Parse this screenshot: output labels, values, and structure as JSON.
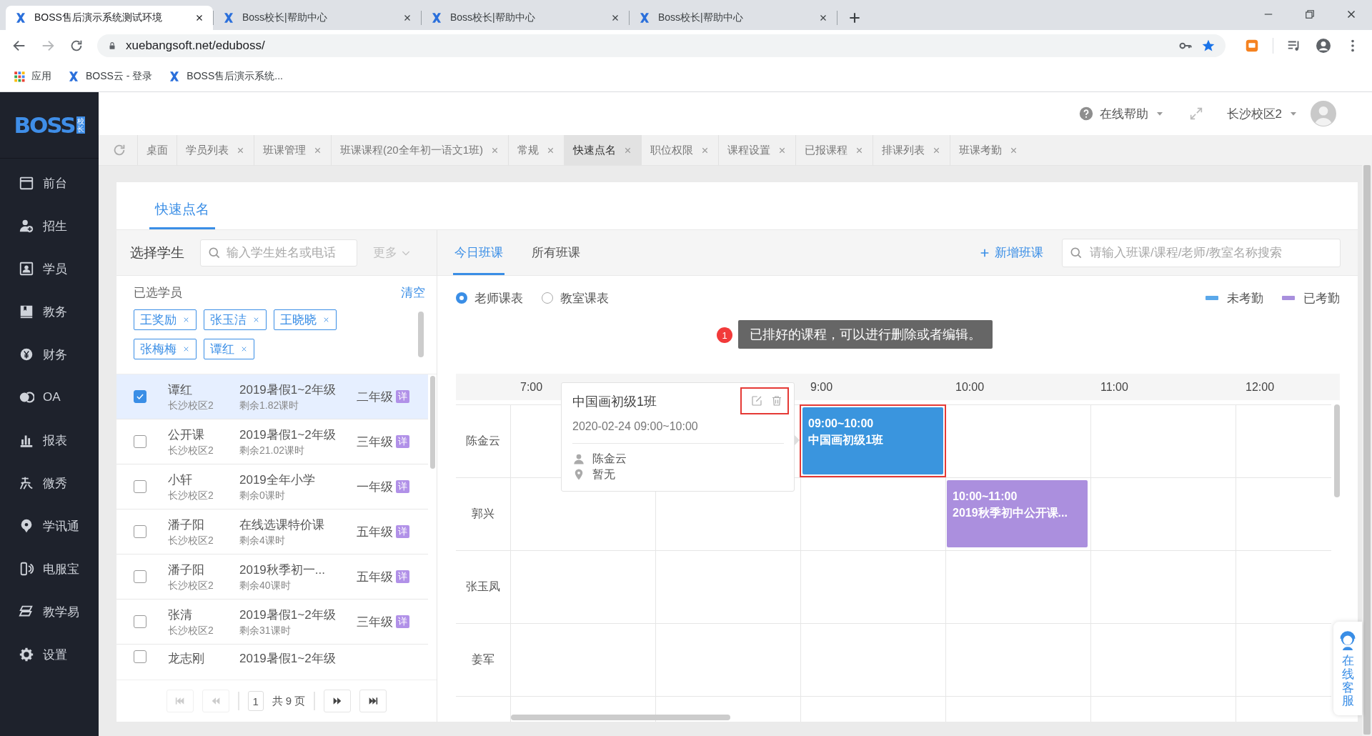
{
  "browser": {
    "tabs": [
      {
        "title": "BOSS售后演示系统测试环境",
        "selected": true
      },
      {
        "title": "Boss校长|帮助中心",
        "selected": false
      },
      {
        "title": "Boss校长|帮助中心",
        "selected": false
      },
      {
        "title": "Boss校长|帮助中心",
        "selected": false
      }
    ],
    "url": "xuebangsoft.net/eduboss/",
    "bookmarks": [
      {
        "label": "应用",
        "kind": "apps"
      },
      {
        "label": "BOSS云 - 登录",
        "kind": "site"
      },
      {
        "label": "BOSS售后演示系统...",
        "kind": "site"
      }
    ]
  },
  "logo": {
    "text": "BOSS",
    "badge": "校长"
  },
  "sidebar": {
    "items": [
      {
        "label": "前台",
        "kind": "calendar"
      },
      {
        "label": "招生",
        "kind": "user-add"
      },
      {
        "label": "学员",
        "kind": "profile"
      },
      {
        "label": "教务",
        "kind": "book"
      },
      {
        "label": "财务",
        "kind": "yen"
      },
      {
        "label": "OA",
        "kind": "chat"
      },
      {
        "label": "报表",
        "kind": "chart"
      },
      {
        "label": "微秀",
        "kind": "brush"
      },
      {
        "label": "学讯通",
        "kind": "pin"
      },
      {
        "label": "电服宝",
        "kind": "phone"
      },
      {
        "label": "教学易",
        "kind": "books"
      },
      {
        "label": "设置",
        "kind": "gear"
      }
    ]
  },
  "header": {
    "help": "在线帮助",
    "campus": "长沙校区2"
  },
  "page_tabs": [
    {
      "label": "桌面",
      "closable": false,
      "selected": false
    },
    {
      "label": "学员列表",
      "closable": true,
      "selected": false
    },
    {
      "label": "班课管理",
      "closable": true,
      "selected": false
    },
    {
      "label": "班课课程(20全年初一语文1班)",
      "closable": true,
      "selected": false
    },
    {
      "label": "常规",
      "closable": true,
      "selected": false
    },
    {
      "label": "快速点名",
      "closable": true,
      "selected": true
    },
    {
      "label": "职位权限",
      "closable": true,
      "selected": false
    },
    {
      "label": "课程设置",
      "closable": true,
      "selected": false
    },
    {
      "label": "已报课程",
      "closable": true,
      "selected": false
    },
    {
      "label": "排课列表",
      "closable": true,
      "selected": false
    },
    {
      "label": "班课考勤",
      "closable": true,
      "selected": false
    }
  ],
  "page_title": "快速点名",
  "students": {
    "heading": "选择学生",
    "search_placeholder": "输入学生姓名或电话",
    "more": "更多",
    "selected_label": "已选学员",
    "clear": "清空",
    "tags": [
      "王奖励",
      "张玉洁",
      "王晓晓",
      "张梅梅",
      "谭红"
    ],
    "rows": [
      {
        "name": "谭红",
        "campus": "长沙校区2",
        "course": "2019暑假1~2年级",
        "remaining": "剩余1.82课时",
        "grade": "二年级",
        "detail": "详",
        "checked": true
      },
      {
        "name": "公开课",
        "campus": "长沙校区2",
        "course": "2019暑假1~2年级",
        "remaining": "剩余21.02课时",
        "grade": "三年级",
        "detail": "详",
        "checked": false
      },
      {
        "name": "小轩",
        "campus": "长沙校区2",
        "course": "2019全年小学",
        "remaining": "剩余0课时",
        "grade": "一年级",
        "detail": "详",
        "checked": false
      },
      {
        "name": "潘子阳",
        "campus": "长沙校区2",
        "course": "在线选课特价课",
        "remaining": "剩余4课时",
        "grade": "五年级",
        "detail": "详",
        "checked": false
      },
      {
        "name": "潘子阳",
        "campus": "长沙校区2",
        "course": "2019秋季初一...",
        "remaining": "剩余40课时",
        "grade": "五年级",
        "detail": "详",
        "checked": false
      },
      {
        "name": "张清",
        "campus": "长沙校区2",
        "course": "2019暑假1~2年级",
        "remaining": "剩余31课时",
        "grade": "三年级",
        "detail": "详",
        "checked": false
      },
      {
        "name": "龙志刚",
        "course": "2019暑假1~2年级",
        "checked": false
      }
    ],
    "pagination": {
      "page": "1",
      "total": "共 9 页"
    }
  },
  "schedule": {
    "tabs": [
      {
        "label": "今日班课",
        "selected": true
      },
      {
        "label": "所有班课",
        "selected": false
      }
    ],
    "add": "新增班课",
    "search_placeholder": "请输入班课/课程/老师/教室名称搜索",
    "views": [
      {
        "label": "老师课表",
        "selected": true
      },
      {
        "label": "教室课表",
        "selected": false
      }
    ],
    "legend": [
      {
        "label": "未考勤",
        "color": "#5aa8ea"
      },
      {
        "label": "已考勤",
        "color": "#a88fdd"
      }
    ],
    "guide": {
      "step": "1",
      "text": "已排好的课程，可以进行删除或者编辑。"
    },
    "hours": [
      {
        "label": "7:00"
      },
      {
        "covered": true
      },
      {
        "label": "9:00"
      },
      {
        "label": "10:00"
      },
      {
        "label": "11:00"
      },
      {
        "label": "12:00"
      }
    ],
    "rows": [
      {
        "teacher": "陈金云",
        "slots": [
          {
            "kind": "empty"
          },
          {
            "kind": "empty"
          },
          {
            "kind": "pending",
            "time": "09:00~10:00",
            "title": "中国画初级1班",
            "highlighted": true
          },
          {
            "kind": "empty"
          },
          {
            "kind": "empty"
          },
          {
            "kind": "empty"
          }
        ]
      },
      {
        "teacher": "郭兴",
        "slots": [
          {
            "kind": "empty"
          },
          {
            "kind": "empty"
          },
          {
            "kind": "empty"
          },
          {
            "kind": "attended",
            "time": "10:00~11:00",
            "title": "2019秋季初中公开课...",
            "highlighted": false
          },
          {
            "kind": "empty"
          },
          {
            "kind": "empty"
          }
        ]
      },
      {
        "teacher": "张玉凤",
        "slots": [
          {
            "kind": "empty"
          },
          {
            "kind": "empty"
          },
          {
            "kind": "empty"
          },
          {
            "kind": "empty"
          },
          {
            "kind": "empty"
          },
          {
            "kind": "empty"
          }
        ]
      },
      {
        "teacher": "姜军",
        "slots": [
          {
            "kind": "empty"
          },
          {
            "kind": "empty"
          },
          {
            "kind": "empty"
          },
          {
            "kind": "empty"
          },
          {
            "kind": "empty"
          },
          {
            "kind": "empty"
          }
        ]
      },
      {
        "slots": [
          {
            "kind": "empty"
          },
          {
            "kind": "empty"
          },
          {
            "kind": "empty"
          },
          {
            "kind": "empty"
          },
          {
            "kind": "empty"
          },
          {
            "kind": "empty"
          }
        ]
      }
    ],
    "popover": {
      "title": "中国画初级1班",
      "date": "2020-02-24 09:00~10:00",
      "teacher": "陈金云",
      "room": "暂无"
    }
  },
  "help_widget": {
    "text": "在线客服"
  }
}
